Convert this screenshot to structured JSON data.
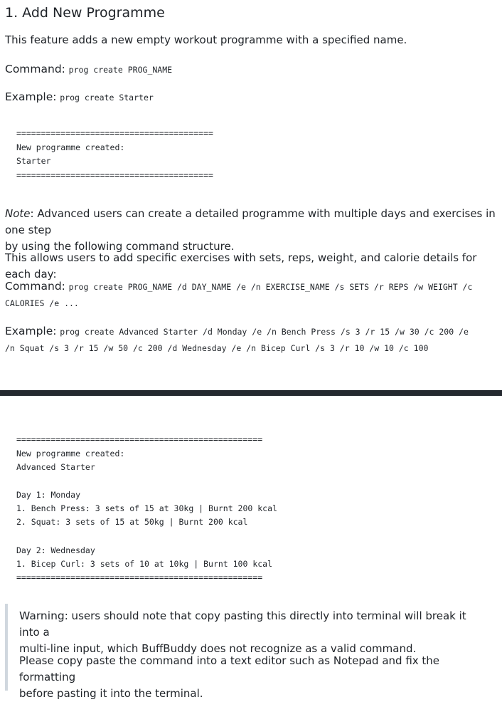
{
  "heading": "1. Add New Programme",
  "intro": "This feature adds a new empty workout programme with a specified name.",
  "simple": {
    "command_label": "Command:",
    "command": "prog create PROG_NAME",
    "example_label": "Example:",
    "example": "prog create Starter"
  },
  "output1": {
    "border": "========================================",
    "line1": "New programme created:",
    "line2": "Starter"
  },
  "note": {
    "label": "Note",
    "text_line1": ": Advanced users can create a detailed programme with multiple days and exercises in one step",
    "text_line2": "by using the following command structure."
  },
  "allows": "This allows users to add specific exercises with sets, reps, weight, and calorie details for each day:",
  "advanced": {
    "command_label": "Command:",
    "command_line1": "prog create PROG_NAME /d DAY_NAME /e /n EXERCISE_NAME /s SETS /r REPS /w WEIGHT /c",
    "command_line2": "CALORIES /e ...",
    "example_label": "Example:",
    "example_line1": "prog create Advanced Starter /d Monday /e /n Bench Press /s 3 /r 15 /w 30 /c 200 /e",
    "example_line2": "/n Squat /s 3 /r 15 /w 50 /c 200 /d Wednesday /e /n Bicep Curl /s 3 /r 10 /w 10 /c 100"
  },
  "output2": {
    "border": "==================================================",
    "line1": "New programme created:",
    "line2": "Advanced Starter",
    "day1": "Day 1: Monday",
    "day1_ex1": "1. Bench Press: 3 sets of 15 at 30kg | Burnt 200 kcal",
    "day1_ex2": "2. Squat: 3 sets of 15 at 50kg | Burnt 200 kcal",
    "day2": "Day 2: Wednesday",
    "day2_ex1": "1. Bicep Curl: 3 sets of 10 at 10kg | Burnt 100 kcal"
  },
  "warning": {
    "label": "Warning",
    "text_line1": ": users should note that copy pasting this directly into terminal will break it into a",
    "text_line2": "multi-line input, which BuffBuddy does not recognize as a valid command.",
    "advice_line1": "Please copy paste the command into a text editor such as Notepad and fix the formatting",
    "advice_line2": "before pasting it into the terminal."
  }
}
